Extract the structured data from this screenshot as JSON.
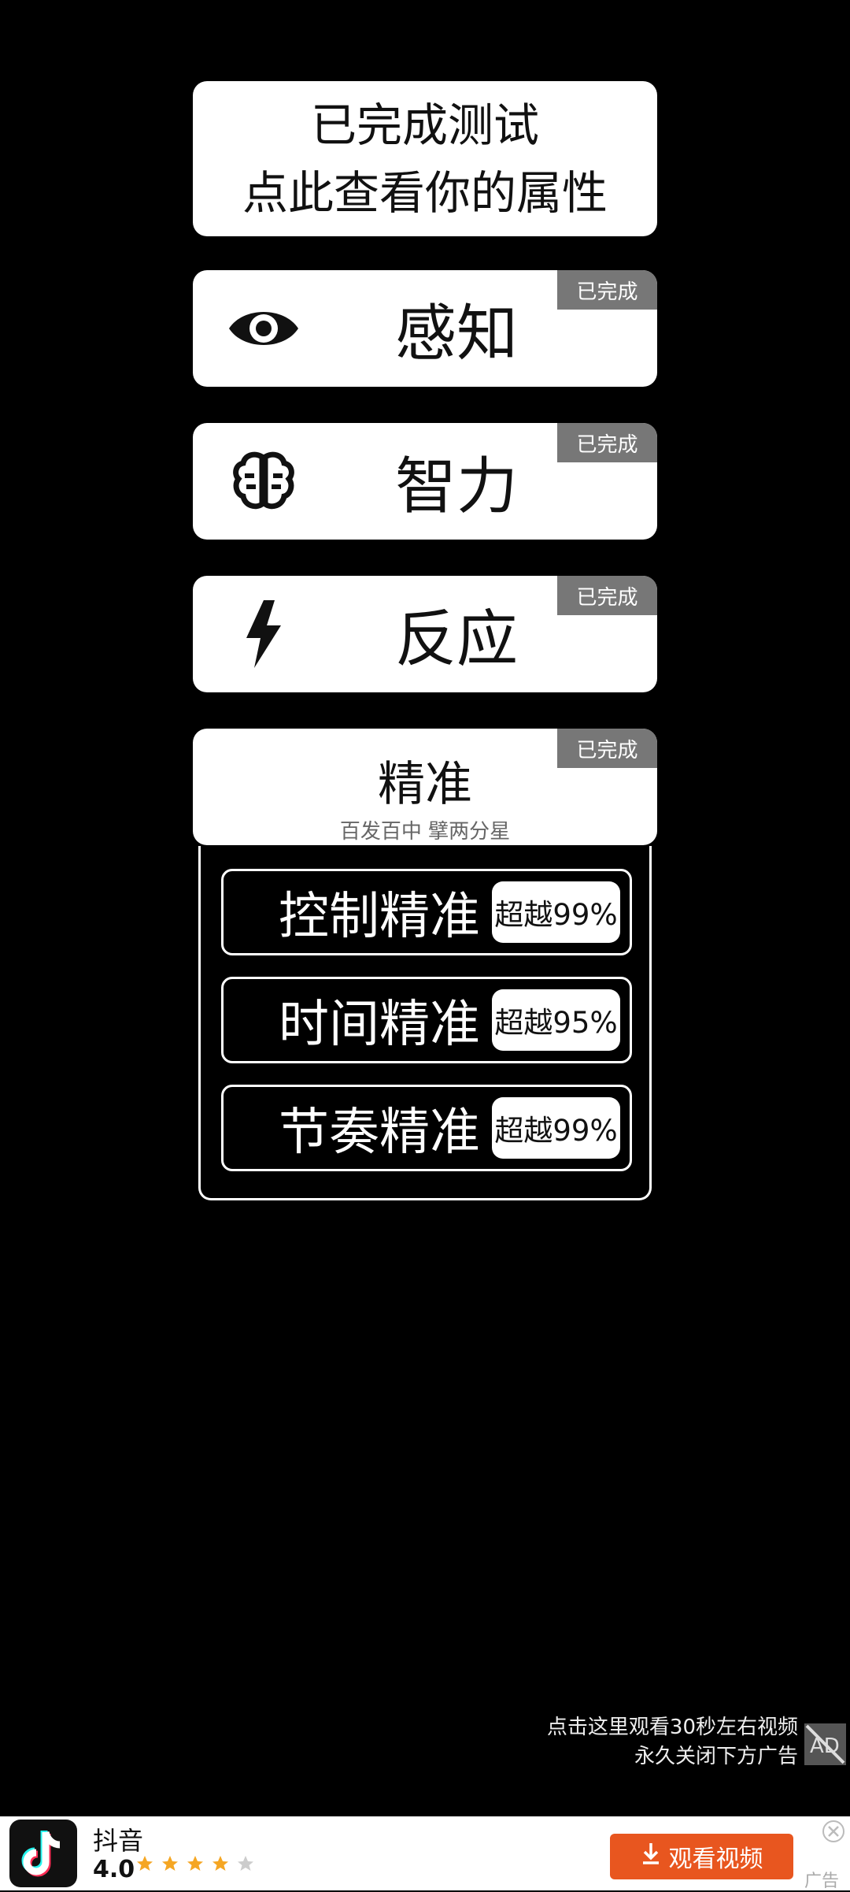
{
  "summary_card": {
    "line1": "已完成测试",
    "line2": "点此查看你的属性"
  },
  "attributes": [
    {
      "label": "感知",
      "badge": "已完成",
      "icon": "eye-icon"
    },
    {
      "label": "智力",
      "badge": "已完成",
      "icon": "brain-icon"
    },
    {
      "label": "反应",
      "badge": "已完成",
      "icon": "lightning-icon"
    }
  ],
  "precision": {
    "title": "精准",
    "badge": "已完成",
    "subtitle": "百发百中 擘两分星",
    "rows": [
      {
        "label": "控制精准",
        "value": "超越99%"
      },
      {
        "label": "时间精准",
        "value": "超越95%"
      },
      {
        "label": "节奏精准",
        "value": "超越99%"
      }
    ]
  },
  "ad_hint": {
    "line1": "点击这里观看30秒左右视频",
    "line2": "永久关闭下方广告"
  },
  "banner": {
    "app_name": "抖音",
    "rating": "4.0",
    "stars_filled": 4,
    "stars_total": 5,
    "cta_label": "观看视频",
    "ad_tag": "广告"
  },
  "colors": {
    "background": "#000000",
    "card": "#ffffff",
    "badge": "#777777",
    "cta": "#e8561f",
    "star": "#f5a623"
  }
}
